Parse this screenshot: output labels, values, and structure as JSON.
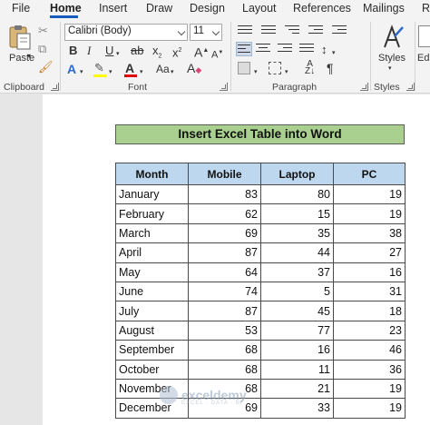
{
  "menu": {
    "tabs": [
      "File",
      "Home",
      "Insert",
      "Draw",
      "Design",
      "Layout",
      "References",
      "Mailings",
      "R"
    ],
    "active": "Home"
  },
  "ribbon": {
    "clipboard": {
      "paste_label": "Paste",
      "group_label": "Clipboard"
    },
    "font": {
      "font_name": "Calibri (Body)",
      "font_size": "11",
      "bold": "B",
      "italic": "I",
      "underline": "U",
      "strike": "ab",
      "subscript": "x",
      "superscript": "x",
      "grow": "A",
      "shrink": "A",
      "case": "Aa",
      "clear": "A",
      "text_effects": "A",
      "font_color": "A",
      "group_label": "Font"
    },
    "paragraph": {
      "group_label": "Paragraph",
      "pilcrow": "¶"
    },
    "styles": {
      "label": "Styles",
      "group_label": "Styles"
    },
    "editing": {
      "label": "Edi"
    }
  },
  "document": {
    "title": "Insert Excel Table into Word",
    "table": {
      "headers": [
        "Month",
        "Mobile",
        "Laptop",
        "PC"
      ],
      "rows": [
        [
          "January",
          "83",
          "80",
          "19"
        ],
        [
          "February",
          "62",
          "15",
          "19"
        ],
        [
          "March",
          "69",
          "35",
          "38"
        ],
        [
          "April",
          "87",
          "44",
          "27"
        ],
        [
          "May",
          "64",
          "37",
          "16"
        ],
        [
          "June",
          "74",
          "5",
          "31"
        ],
        [
          "July",
          "87",
          "45",
          "18"
        ],
        [
          "August",
          "53",
          "77",
          "23"
        ],
        [
          "September",
          "68",
          "16",
          "46"
        ],
        [
          "October",
          "68",
          "11",
          "36"
        ],
        [
          "November",
          "68",
          "21",
          "19"
        ],
        [
          "December",
          "69",
          "33",
          "19"
        ]
      ]
    },
    "watermark": {
      "brand": "exceldemy",
      "tagline": "EXCEL · DATA · BI"
    }
  },
  "colors": {
    "title_fill": "#a9d08e",
    "header_fill": "#bdd7ee",
    "accent": "#185abd"
  }
}
